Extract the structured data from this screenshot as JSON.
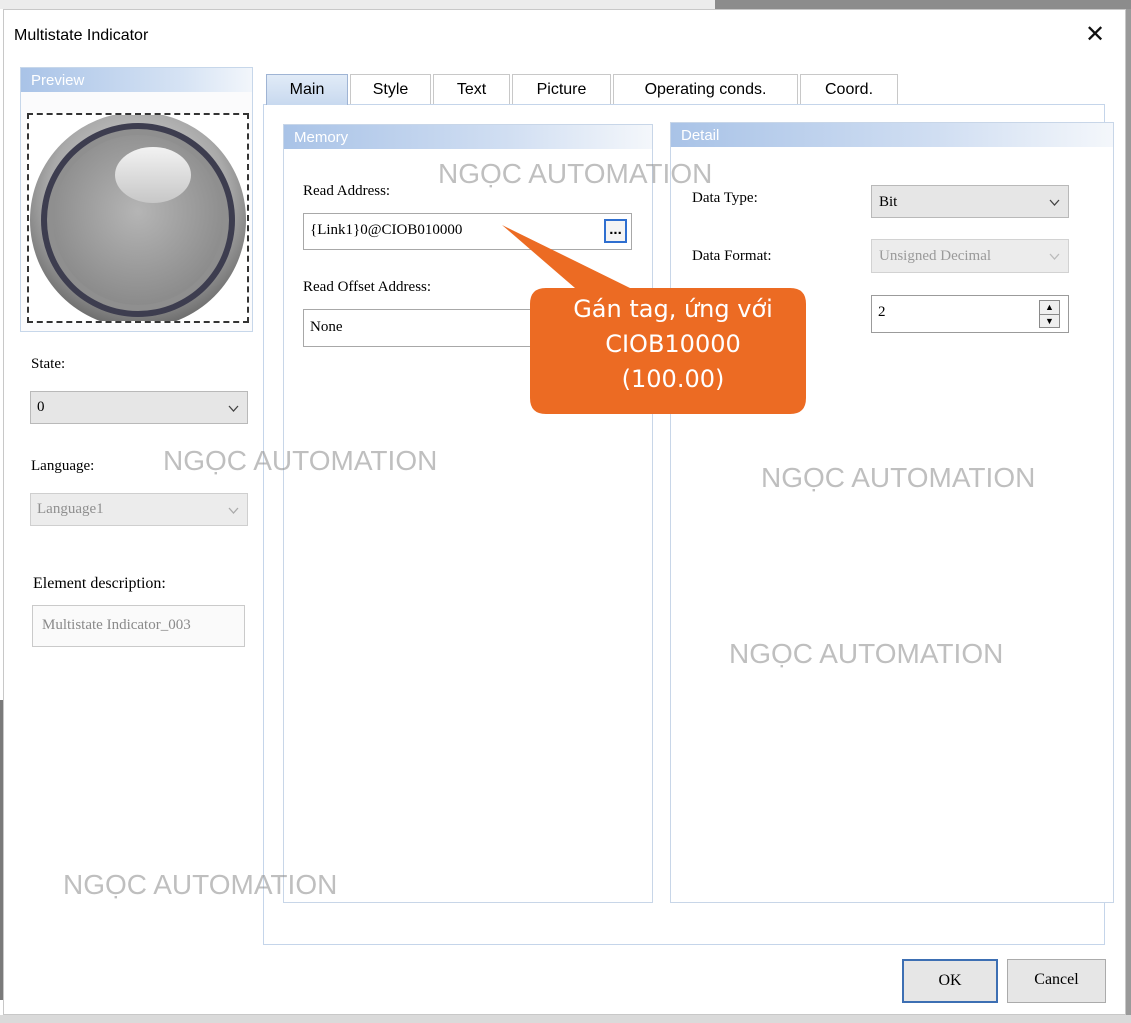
{
  "window": {
    "title": "Multistate Indicator",
    "close_glyph": "✕"
  },
  "preview": {
    "header": "Preview"
  },
  "left_panel": {
    "state_label": "State:",
    "state_value": "0",
    "language_label": "Language:",
    "language_value": "Language1",
    "description_label": "Element description:",
    "description_value": "Multistate Indicator_003"
  },
  "tabs": [
    {
      "label": "Main",
      "active": true
    },
    {
      "label": "Style",
      "active": false
    },
    {
      "label": "Text",
      "active": false
    },
    {
      "label": "Picture",
      "active": false
    },
    {
      "label": "Operating conds.",
      "active": false
    },
    {
      "label": "Coord.",
      "active": false
    }
  ],
  "memory": {
    "header": "Memory",
    "read_address_label": "Read Address:",
    "read_address_value": "{Link1}0@CIOB010000",
    "browse_label": "...",
    "read_offset_label": "Read Offset Address:",
    "read_offset_value": "None"
  },
  "detail": {
    "header": "Detail",
    "data_type_label": "Data Type:",
    "data_type_value": "Bit",
    "data_format_label": "Data Format:",
    "data_format_value": "Unsigned Decimal",
    "count_value": "2"
  },
  "callout": {
    "line1": "Gán tag, ứng với",
    "line2": "CIOB10000",
    "line3": "(100.00)",
    "color": "#ec6b23"
  },
  "watermark": "NGỌC AUTOMATION",
  "buttons": {
    "ok": "OK",
    "cancel": "Cancel"
  },
  "icons": {
    "close": "close-icon",
    "dropdown": "chevron-down-icon",
    "spin_up": "arrow-up-icon",
    "spin_down": "arrow-down-icon"
  }
}
